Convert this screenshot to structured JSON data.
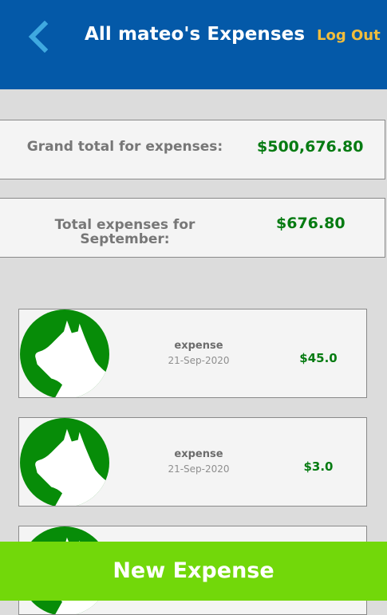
{
  "header": {
    "title": "All mateo's Expenses",
    "logout_label": "Log Out",
    "back_icon": "chevron-left-icon"
  },
  "summary": {
    "grand_total_label": "Grand total for expenses:",
    "grand_total_value": "$500,676.80",
    "month_total_label": "Total expenses for September:",
    "month_total_value": "$676.80"
  },
  "expenses": [
    {
      "name": "expense",
      "date": "21-Sep-2020",
      "amount": "$45.0",
      "icon": "dog-head-avatar-icon"
    },
    {
      "name": "expense",
      "date": "21-Sep-2020",
      "amount": "$3.0",
      "icon": "dog-head-avatar-icon"
    },
    {
      "icon": "dog-head-avatar-icon"
    }
  ],
  "footer": {
    "new_expense_label": "New Expense"
  },
  "colors": {
    "header_bg": "#0459a8",
    "back_icon": "#3fa9e0",
    "logout": "#f1bd3c",
    "amount_green": "#067b12",
    "avatar_green": "#078c08",
    "button_green": "#72d80a",
    "page_bg": "#dcdcdc"
  }
}
